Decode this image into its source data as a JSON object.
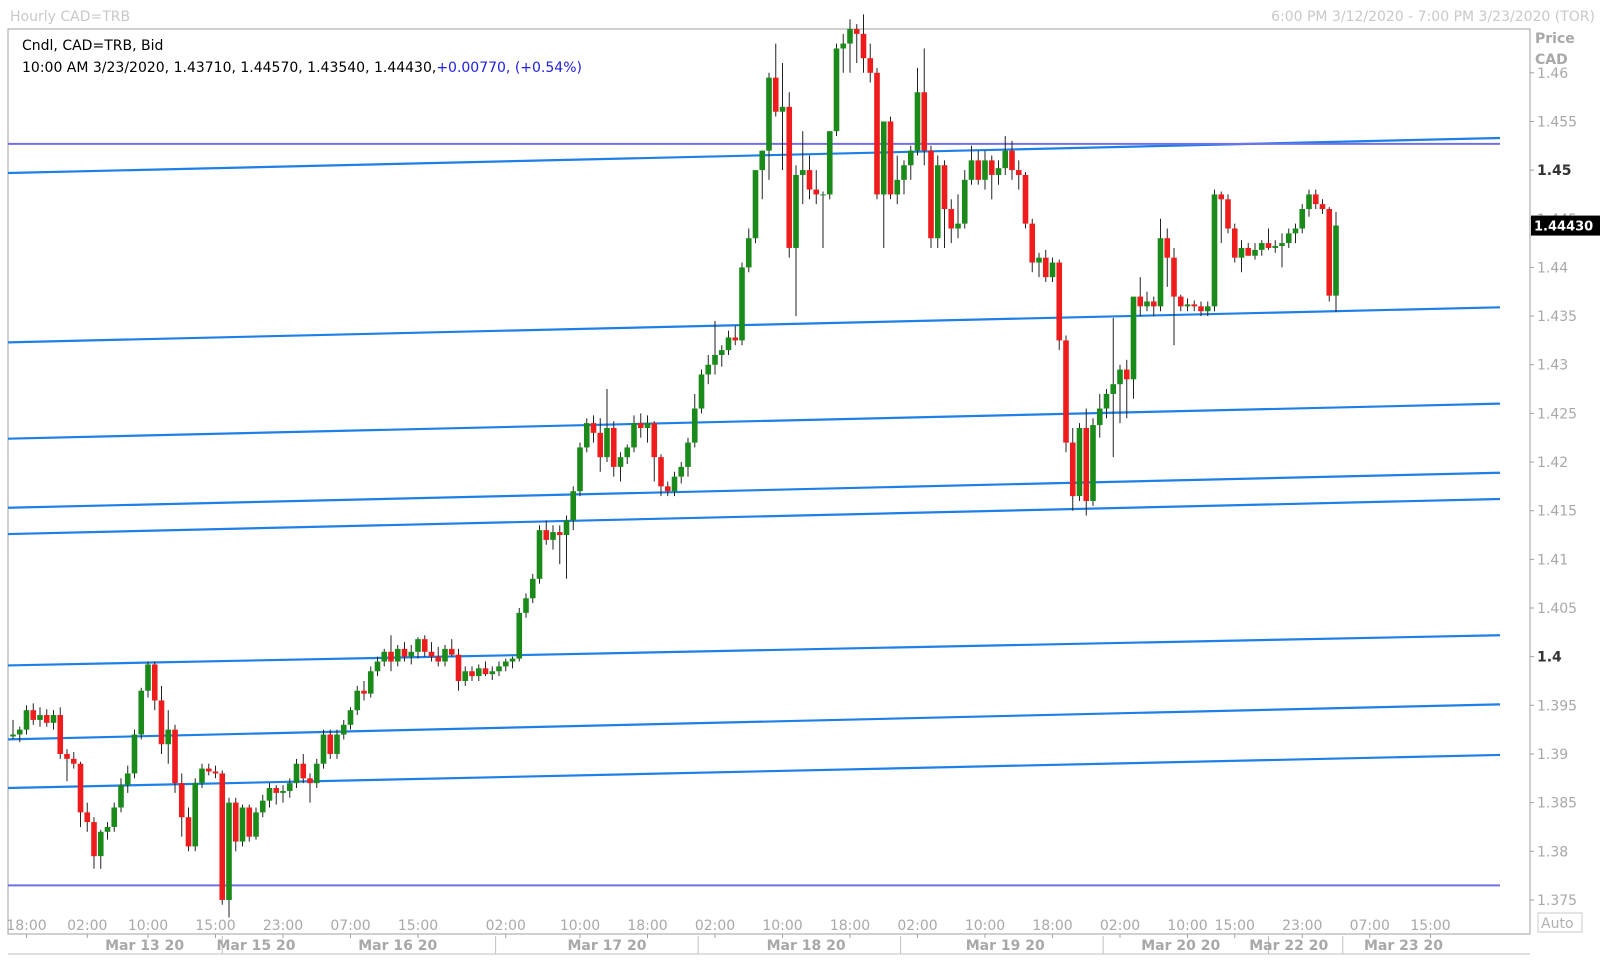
{
  "header": {
    "title": "Hourly CAD=TRB",
    "range": "6:00 PM 3/12/2020 - 7:00 PM 3/23/2020 (TOR)"
  },
  "legend": {
    "line1": "Cndl, CAD=TRB, Bid",
    "line2_prefix": "10:00 AM 3/23/2020, 1.43710, 1.44570, 1.43540, 1.44430,",
    "line2_change": "+0.00770, (+0.54%)"
  },
  "price_axis": {
    "title_line1": "Price",
    "title_line2": "CAD",
    "auto_label": "Auto",
    "last_price_label": "1.44430"
  },
  "colors": {
    "up": "#1a8a1a",
    "down": "#ee1c1c",
    "trendline": "#1e7fe6",
    "hline": "#7070e8",
    "frame": "#a0a0a0"
  },
  "chart_data": {
    "type": "candlestick",
    "title": "Hourly CAD=TRB",
    "ylabel": "Price CAD",
    "ylim": [
      1.3715,
      1.4645
    ],
    "y_ticks": [
      "1.375",
      "1.38",
      "1.385",
      "1.39",
      "1.395",
      "1.4",
      "1.405",
      "1.41",
      "1.415",
      "1.42",
      "1.425",
      "1.43",
      "1.435",
      "1.44",
      "1.445",
      "1.45",
      "1.455",
      "1.46"
    ],
    "y_tick_values": [
      1.375,
      1.38,
      1.385,
      1.39,
      1.395,
      1.4,
      1.405,
      1.41,
      1.415,
      1.42,
      1.425,
      1.43,
      1.435,
      1.44,
      1.445,
      1.45,
      1.455,
      1.46
    ],
    "bold_ticks": [
      "1.4",
      "1.45"
    ],
    "x_tick_labels": [
      "18:00",
      "02:00",
      "10:00",
      "15:00",
      "23:00",
      "07:00",
      "15:00",
      "02:00",
      "10:00",
      "18:00",
      "02:00",
      "10:00",
      "18:00",
      "02:00",
      "10:00",
      "18:00",
      "02:00",
      "10:00",
      "15:00",
      "23:00",
      "07:00",
      "15:00"
    ],
    "x_tick_bars": [
      2,
      11,
      20,
      30,
      40,
      50,
      60,
      73,
      84,
      94,
      104,
      114,
      124,
      134,
      144,
      154,
      164,
      174,
      181,
      191,
      201,
      210
    ],
    "date_labels": [
      "Mar 13 20",
      "Mar 15 20",
      "Mar 16 20",
      "Mar 17 20",
      "Mar 18 20",
      "Mar 19 20",
      "Mar 20 20",
      "Mar 22 20",
      "Mar 23 20"
    ],
    "date_label_bars": [
      19.5,
      36,
      57,
      88,
      117.5,
      147,
      173,
      189,
      206
    ],
    "date_sep_bars": [
      31,
      71.5,
      101.5,
      131.5,
      161.5,
      186,
      197
    ],
    "last_price": 1.4443,
    "hlines": [
      1.4527,
      1.3765
    ],
    "trendlines": [
      {
        "y_start": 1.4497,
        "y_end": 1.4533
      },
      {
        "y_start": 1.4323,
        "y_end": 1.4359
      },
      {
        "y_start": 1.4224,
        "y_end": 1.426
      },
      {
        "y_start": 1.4153,
        "y_end": 1.4189
      },
      {
        "y_start": 1.4126,
        "y_end": 1.4162
      },
      {
        "y_start": 1.3991,
        "y_end": 1.4022
      },
      {
        "y_start": 1.3915,
        "y_end": 1.3951
      },
      {
        "y_start": 1.3865,
        "y_end": 1.3899
      }
    ],
    "candles": [
      [
        1.3918,
        1.3935,
        1.3915,
        1.392
      ],
      [
        1.392,
        1.3928,
        1.3912,
        1.3925
      ],
      [
        1.3925,
        1.395,
        1.392,
        1.3945
      ],
      [
        1.3945,
        1.3952,
        1.393,
        1.3935
      ],
      [
        1.3935,
        1.3948,
        1.3928,
        1.394
      ],
      [
        1.394,
        1.3946,
        1.3928,
        1.3932
      ],
      [
        1.3932,
        1.3945,
        1.3925,
        1.394
      ],
      [
        1.394,
        1.3948,
        1.3895,
        1.39
      ],
      [
        1.39,
        1.3905,
        1.3872,
        1.3895
      ],
      [
        1.3895,
        1.3902,
        1.3885,
        1.389
      ],
      [
        1.389,
        1.3892,
        1.3825,
        1.384
      ],
      [
        1.384,
        1.385,
        1.382,
        1.383
      ],
      [
        1.383,
        1.3835,
        1.3782,
        1.3795
      ],
      [
        1.3795,
        1.3822,
        1.3782,
        1.382
      ],
      [
        1.382,
        1.383,
        1.3812,
        1.3825
      ],
      [
        1.3825,
        1.385,
        1.382,
        1.3845
      ],
      [
        1.3845,
        1.3875,
        1.384,
        1.3868
      ],
      [
        1.3868,
        1.3888,
        1.386,
        1.388
      ],
      [
        1.388,
        1.3925,
        1.3875,
        1.392
      ],
      [
        1.392,
        1.3968,
        1.3915,
        1.3965
      ],
      [
        1.3965,
        1.3995,
        1.3958,
        1.3992
      ],
      [
        1.3992,
        1.3995,
        1.3945,
        1.3955
      ],
      [
        1.3955,
        1.397,
        1.39,
        1.391
      ],
      [
        1.391,
        1.3945,
        1.389,
        1.3925
      ],
      [
        1.3925,
        1.393,
        1.386,
        1.387
      ],
      [
        1.387,
        1.388,
        1.3815,
        1.3835
      ],
      [
        1.3835,
        1.3845,
        1.38,
        1.3805
      ],
      [
        1.3805,
        1.3875,
        1.38,
        1.387
      ],
      [
        1.387,
        1.389,
        1.3865,
        1.3885
      ],
      [
        1.3885,
        1.389,
        1.3878,
        1.3882
      ],
      [
        1.3882,
        1.3888,
        1.3875,
        1.388
      ],
      [
        1.388,
        1.3883,
        1.3745,
        1.375
      ],
      [
        1.375,
        1.3855,
        1.3732,
        1.385
      ],
      [
        1.385,
        1.3855,
        1.38,
        1.381
      ],
      [
        1.381,
        1.3848,
        1.3805,
        1.3845
      ],
      [
        1.3845,
        1.3848,
        1.381,
        1.3815
      ],
      [
        1.3815,
        1.3845,
        1.3812,
        1.384
      ],
      [
        1.384,
        1.3858,
        1.3835,
        1.3852
      ],
      [
        1.3852,
        1.387,
        1.3845,
        1.3865
      ],
      [
        1.3865,
        1.3868,
        1.3848,
        1.386
      ],
      [
        1.386,
        1.3868,
        1.385,
        1.3862
      ],
      [
        1.3862,
        1.3875,
        1.3855,
        1.387
      ],
      [
        1.387,
        1.3895,
        1.3865,
        1.389
      ],
      [
        1.389,
        1.39,
        1.387,
        1.3875
      ],
      [
        1.3875,
        1.388,
        1.385,
        1.387
      ],
      [
        1.387,
        1.3895,
        1.3865,
        1.389
      ],
      [
        1.389,
        1.3925,
        1.3885,
        1.392
      ],
      [
        1.392,
        1.3925,
        1.3895,
        1.39
      ],
      [
        1.39,
        1.3925,
        1.3895,
        1.392
      ],
      [
        1.392,
        1.3935,
        1.3915,
        1.393
      ],
      [
        1.393,
        1.3948,
        1.3925,
        1.3945
      ],
      [
        1.3945,
        1.397,
        1.394,
        1.3965
      ],
      [
        1.3965,
        1.3975,
        1.3955,
        1.3962
      ],
      [
        1.3962,
        1.399,
        1.3958,
        1.3985
      ],
      [
        1.3985,
        1.4,
        1.398,
        1.3995
      ],
      [
        1.3995,
        1.4008,
        1.399,
        1.4005
      ],
      [
        1.4005,
        1.4022,
        1.3985,
        1.3995
      ],
      [
        1.3995,
        1.4012,
        1.399,
        1.4008
      ],
      [
        1.4008,
        1.4015,
        1.3995,
        1.4
      ],
      [
        1.4,
        1.4012,
        1.3992,
        1.4005
      ],
      [
        1.4005,
        1.402,
        1.3998,
        1.4018
      ],
      [
        1.4018,
        1.4022,
        1.4,
        1.4005
      ],
      [
        1.4005,
        1.4015,
        1.3995,
        1.4
      ],
      [
        1.4,
        1.401,
        1.399,
        1.3995
      ],
      [
        1.3995,
        1.4012,
        1.399,
        1.4008
      ],
      [
        1.4008,
        1.4018,
        1.4,
        1.4002
      ],
      [
        1.4002,
        1.4008,
        1.3965,
        1.3975
      ],
      [
        1.3975,
        1.399,
        1.397,
        1.3985
      ],
      [
        1.3985,
        1.399,
        1.3975,
        1.398
      ],
      [
        1.398,
        1.3992,
        1.3975,
        1.3988
      ],
      [
        1.3988,
        1.3995,
        1.398,
        1.3982
      ],
      [
        1.3982,
        1.399,
        1.3976,
        1.3985
      ],
      [
        1.3985,
        1.3995,
        1.398,
        1.399
      ],
      [
        1.399,
        1.3998,
        1.3985,
        1.3995
      ],
      [
        1.3995,
        1.4,
        1.3988,
        1.3998
      ],
      [
        1.3998,
        1.405,
        1.3995,
        1.4045
      ],
      [
        1.4045,
        1.4065,
        1.404,
        1.406
      ],
      [
        1.406,
        1.4085,
        1.4055,
        1.408
      ],
      [
        1.408,
        1.4135,
        1.4075,
        1.413
      ],
      [
        1.413,
        1.414,
        1.4115,
        1.412
      ],
      [
        1.412,
        1.4135,
        1.411,
        1.4128
      ],
      [
        1.4128,
        1.4135,
        1.4095,
        1.4125
      ],
      [
        1.4125,
        1.4145,
        1.408,
        1.414
      ],
      [
        1.414,
        1.4175,
        1.413,
        1.417
      ],
      [
        1.417,
        1.422,
        1.4165,
        1.4215
      ],
      [
        1.4215,
        1.4245,
        1.421,
        1.424
      ],
      [
        1.424,
        1.4248,
        1.422,
        1.423
      ],
      [
        1.423,
        1.4245,
        1.419,
        1.4205
      ],
      [
        1.4205,
        1.4275,
        1.42,
        1.4235
      ],
      [
        1.4235,
        1.4242,
        1.4185,
        1.4195
      ],
      [
        1.4195,
        1.421,
        1.418,
        1.4205
      ],
      [
        1.4205,
        1.4218,
        1.4198,
        1.4215
      ],
      [
        1.4215,
        1.4248,
        1.421,
        1.424
      ],
      [
        1.424,
        1.425,
        1.4225,
        1.4235
      ],
      [
        1.4235,
        1.4248,
        1.422,
        1.424
      ],
      [
        1.424,
        1.4242,
        1.418,
        1.4205
      ],
      [
        1.4205,
        1.4208,
        1.4165,
        1.4175
      ],
      [
        1.4175,
        1.418,
        1.4165,
        1.417
      ],
      [
        1.417,
        1.419,
        1.4165,
        1.4185
      ],
      [
        1.4185,
        1.42,
        1.4178,
        1.4195
      ],
      [
        1.4195,
        1.4225,
        1.4185,
        1.422
      ],
      [
        1.422,
        1.427,
        1.4215,
        1.4255
      ],
      [
        1.4255,
        1.4295,
        1.425,
        1.429
      ],
      [
        1.429,
        1.431,
        1.428,
        1.43
      ],
      [
        1.43,
        1.4345,
        1.429,
        1.431
      ],
      [
        1.431,
        1.432,
        1.4298,
        1.4315
      ],
      [
        1.4315,
        1.4335,
        1.431,
        1.4328
      ],
      [
        1.4328,
        1.434,
        1.432,
        1.4325
      ],
      [
        1.4325,
        1.4405,
        1.432,
        1.44
      ],
      [
        1.44,
        1.444,
        1.4395,
        1.443
      ],
      [
        1.443,
        1.4495,
        1.4425,
        1.45
      ],
      [
        1.45,
        1.452,
        1.447,
        1.452
      ],
      [
        1.452,
        1.46,
        1.449,
        1.4595
      ],
      [
        1.4595,
        1.463,
        1.4555,
        1.456
      ],
      [
        1.456,
        1.461,
        1.45,
        1.4565
      ],
      [
        1.4565,
        1.458,
        1.441,
        1.442
      ],
      [
        1.442,
        1.4505,
        1.435,
        1.4495
      ],
      [
        1.4495,
        1.454,
        1.4465,
        1.45
      ],
      [
        1.45,
        1.4515,
        1.447,
        1.448
      ],
      [
        1.448,
        1.45,
        1.4465,
        1.4475
      ],
      [
        1.4475,
        1.4478,
        1.442,
        1.4475
      ],
      [
        1.4475,
        1.454,
        1.447,
        1.454
      ],
      [
        1.454,
        1.463,
        1.4535,
        1.4625
      ],
      [
        1.4625,
        1.464,
        1.46,
        1.463
      ],
      [
        1.463,
        1.4655,
        1.46,
        1.4645
      ],
      [
        1.4645,
        1.465,
        1.461,
        1.464
      ],
      [
        1.464,
        1.466,
        1.46,
        1.4615
      ],
      [
        1.4615,
        1.463,
        1.459,
        1.46
      ],
      [
        1.46,
        1.4605,
        1.447,
        1.4475
      ],
      [
        1.4475,
        1.4495,
        1.442,
        1.455
      ],
      [
        1.455,
        1.4555,
        1.447,
        1.4475
      ],
      [
        1.4475,
        1.4515,
        1.4465,
        1.449
      ],
      [
        1.449,
        1.451,
        1.4475,
        1.4505
      ],
      [
        1.4505,
        1.4525,
        1.449,
        1.452
      ],
      [
        1.452,
        1.4605,
        1.4515,
        1.458
      ],
      [
        1.458,
        1.4625,
        1.4505,
        1.452
      ],
      [
        1.452,
        1.4525,
        1.442,
        1.443
      ],
      [
        1.443,
        1.4515,
        1.442,
        1.4505
      ],
      [
        1.4505,
        1.451,
        1.442,
        1.446
      ],
      [
        1.446,
        1.447,
        1.4425,
        1.444
      ],
      [
        1.444,
        1.4475,
        1.443,
        1.4445
      ],
      [
        1.4445,
        1.45,
        1.444,
        1.449
      ],
      [
        1.449,
        1.4525,
        1.4485,
        1.451
      ],
      [
        1.451,
        1.452,
        1.4485,
        1.449
      ],
      [
        1.449,
        1.452,
        1.448,
        1.451
      ],
      [
        1.451,
        1.4515,
        1.447,
        1.4495
      ],
      [
        1.4495,
        1.451,
        1.4485,
        1.4502
      ],
      [
        1.4502,
        1.4535,
        1.4495,
        1.452
      ],
      [
        1.452,
        1.453,
        1.449,
        1.45
      ],
      [
        1.45,
        1.451,
        1.448,
        1.4495
      ],
      [
        1.4495,
        1.4498,
        1.444,
        1.4445
      ],
      [
        1.4445,
        1.445,
        1.4395,
        1.4405
      ],
      [
        1.4405,
        1.4415,
        1.439,
        1.441
      ],
      [
        1.441,
        1.4418,
        1.4385,
        1.439
      ],
      [
        1.439,
        1.441,
        1.4385,
        1.4405
      ],
      [
        1.4405,
        1.4408,
        1.4315,
        1.4325
      ],
      [
        1.4325,
        1.433,
        1.421,
        1.422
      ],
      [
        1.422,
        1.4235,
        1.415,
        1.4165
      ],
      [
        1.4165,
        1.424,
        1.416,
        1.4235
      ],
      [
        1.4235,
        1.4255,
        1.4145,
        1.416
      ],
      [
        1.416,
        1.4245,
        1.4155,
        1.4238
      ],
      [
        1.4238,
        1.427,
        1.4225,
        1.4255
      ],
      [
        1.4255,
        1.4275,
        1.4245,
        1.427
      ],
      [
        1.427,
        1.4348,
        1.4205,
        1.428
      ],
      [
        1.428,
        1.43,
        1.424,
        1.4295
      ],
      [
        1.4295,
        1.4305,
        1.4245,
        1.4285
      ],
      [
        1.4285,
        1.4305,
        1.4265,
        1.437
      ],
      [
        1.437,
        1.439,
        1.435,
        1.436
      ],
      [
        1.436,
        1.4375,
        1.4355,
        1.4365
      ],
      [
        1.4365,
        1.437,
        1.435,
        1.436
      ],
      [
        1.436,
        1.445,
        1.4355,
        1.443
      ],
      [
        1.443,
        1.444,
        1.438,
        1.441
      ],
      [
        1.441,
        1.442,
        1.432,
        1.437
      ],
      [
        1.437,
        1.4372,
        1.4355,
        1.436
      ],
      [
        1.436,
        1.4368,
        1.4355,
        1.4362
      ],
      [
        1.4362,
        1.4366,
        1.4355,
        1.436
      ],
      [
        1.436,
        1.4365,
        1.435,
        1.4355
      ],
      [
        1.4355,
        1.4365,
        1.435,
        1.436
      ],
      [
        1.436,
        1.448,
        1.4355,
        1.4475
      ],
      [
        1.4475,
        1.4478,
        1.4425,
        1.447
      ],
      [
        1.447,
        1.4475,
        1.4435,
        1.444
      ],
      [
        1.444,
        1.4445,
        1.4405,
        1.441
      ],
      [
        1.441,
        1.4428,
        1.4395,
        1.442
      ],
      [
        1.442,
        1.4425,
        1.4412,
        1.4412
      ],
      [
        1.4412,
        1.4425,
        1.4408,
        1.4418
      ],
      [
        1.4418,
        1.4428,
        1.4412,
        1.4425
      ],
      [
        1.4425,
        1.444,
        1.4418,
        1.442
      ],
      [
        1.442,
        1.4428,
        1.4415,
        1.4422
      ],
      [
        1.4422,
        1.4435,
        1.44,
        1.4425
      ],
      [
        1.4425,
        1.444,
        1.442,
        1.4435
      ],
      [
        1.4435,
        1.4445,
        1.4425,
        1.444
      ],
      [
        1.444,
        1.4465,
        1.4435,
        1.446
      ],
      [
        1.446,
        1.448,
        1.4452,
        1.4475
      ],
      [
        1.4475,
        1.448,
        1.446,
        1.4465
      ],
      [
        1.4465,
        1.447,
        1.4455,
        1.446
      ],
      [
        1.446,
        1.4462,
        1.4365,
        1.4371
      ],
      [
        1.4371,
        1.4457,
        1.4354,
        1.4443
      ]
    ]
  }
}
